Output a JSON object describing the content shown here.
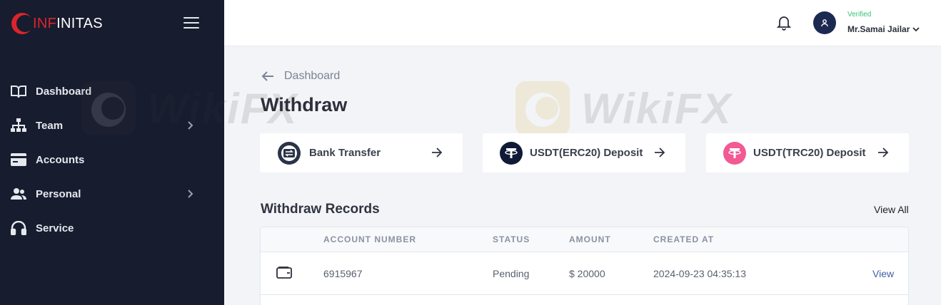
{
  "brand": {
    "name_red": "INF",
    "name_rest": "INITAS"
  },
  "sidebar": {
    "items": [
      {
        "label": "Dashboard",
        "icon": "book-open-icon"
      },
      {
        "label": "Team",
        "icon": "sitemap-icon",
        "has_submenu": true
      },
      {
        "label": "Accounts",
        "icon": "credit-card-icon"
      },
      {
        "label": "Personal",
        "icon": "users-icon",
        "has_submenu": true
      },
      {
        "label": "Service",
        "icon": "headset-icon"
      }
    ]
  },
  "header": {
    "user_status": "Verified",
    "user_name": "Mr.Samai Jailar"
  },
  "main": {
    "breadcrumb": "Dashboard",
    "title": "Withdraw",
    "methods": [
      {
        "label": "Bank Transfer",
        "icon": "bank-transfer-icon"
      },
      {
        "label": "USDT(ERC20) Deposit",
        "icon": "tether-icon"
      },
      {
        "label": "USDT(TRC20) Deposit",
        "icon": "tether-icon"
      }
    ],
    "records": {
      "title": "Withdraw Records",
      "view_all": "View All",
      "columns": [
        "ACCOUNT NUMBER",
        "STATUS",
        "AMOUNT",
        "CREATED AT"
      ],
      "rows": [
        {
          "account_number": "6915967",
          "status": "Pending",
          "amount": "$ 20000",
          "created_at": "2024-09-23 04:35:13",
          "action": "View"
        }
      ]
    }
  },
  "watermark": "WikiFX",
  "colors": {
    "sidebar_bg": "#171c2e",
    "brand_red": "#d9252b",
    "verified_green": "#33c27a",
    "link_blue": "#3f5fa8",
    "erc20": "#1c2a52",
    "trc20": "#f25a93"
  }
}
